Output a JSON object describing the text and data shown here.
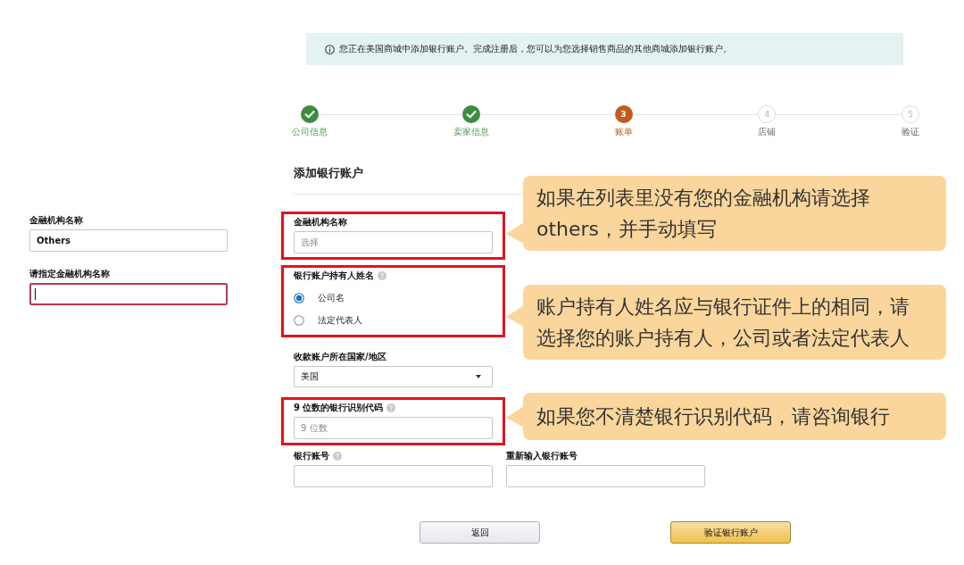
{
  "banner": {
    "text": "您正在美国商城中添加银行账户。完成注册后，您可以为您选择销售商品的其他商城添加银行账户。"
  },
  "steps": [
    {
      "label": "公司信息",
      "kind": "done"
    },
    {
      "label": "卖家信息",
      "kind": "done"
    },
    {
      "number": "3",
      "label": "账单",
      "kind": "current"
    },
    {
      "number": "4",
      "label": "店铺",
      "kind": "pending"
    },
    {
      "number": "5",
      "label": "验证",
      "kind": "pending"
    }
  ],
  "heading": "添加银行账户",
  "side_panel": {
    "fields": [
      {
        "label": "金融机构名称",
        "value": "Others",
        "focused": false
      },
      {
        "label": "请指定金融机构名称",
        "focused": true
      }
    ]
  },
  "form": {
    "rows": [
      {
        "highlighted": true,
        "note": "如果在列表里没有您的金融机构请选择others，并手动填写",
        "fields": [
          {
            "kind": "text",
            "label": "金融机构名称",
            "placeholder": "选择"
          }
        ]
      },
      {
        "highlighted": true,
        "note": "账户持有人姓名应与银行证件上的相同，请选择您的账户持有人，公司或者法定代表人",
        "fields": [
          {
            "kind": "radio",
            "label": "银行账户持有人姓名",
            "help": true,
            "options": [
              {
                "label": "公司名",
                "selected": true
              },
              {
                "label": "法定代表人",
                "selected": false
              }
            ]
          }
        ]
      },
      {
        "fields": [
          {
            "kind": "select",
            "label": "收款账户所在国家/地区",
            "value": "美国"
          }
        ]
      },
      {
        "highlighted": true,
        "note": "如果您不清楚银行识别代码，请咨询银行",
        "fields": [
          {
            "kind": "text",
            "label": "9 位数的银行识别代码",
            "placeholder": "9 位数",
            "help": true
          }
        ]
      },
      {
        "fields": [
          {
            "kind": "text",
            "label": "银行账号",
            "help": true
          },
          {
            "kind": "text",
            "label": "重新输入银行账号"
          }
        ]
      }
    ]
  },
  "buttons": [
    {
      "label": "返回",
      "kind": "secondary"
    },
    {
      "label": "验证银行账户",
      "kind": "primary"
    }
  ]
}
